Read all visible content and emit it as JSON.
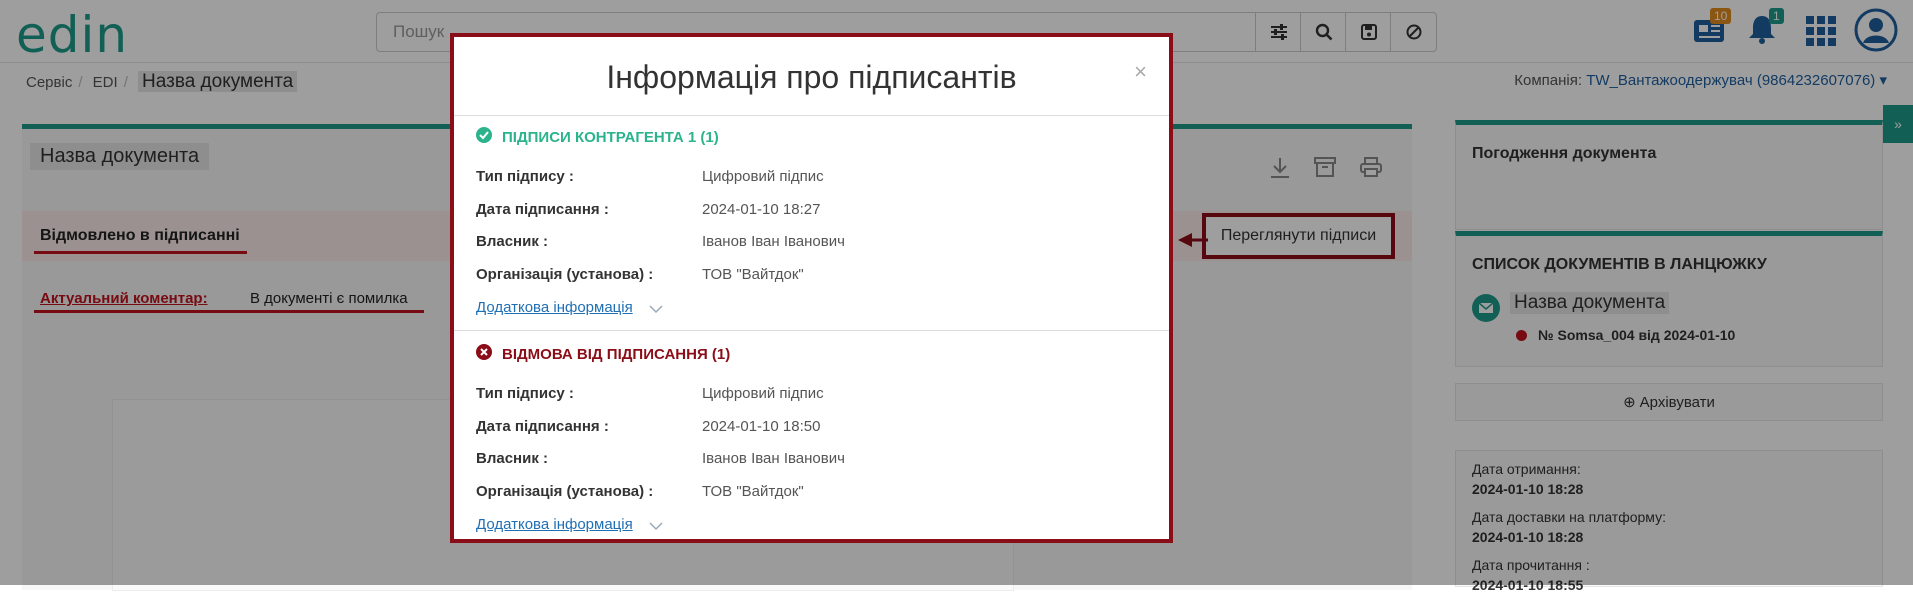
{
  "header": {
    "logo": "edin",
    "search_placeholder": "Пошук",
    "news_badge": "10",
    "notif_badge": "1"
  },
  "breadcrumbs": [
    "Сервіс",
    "EDI",
    "Назва документа"
  ],
  "company": {
    "label": "Компанія:",
    "name": "TW_Вантажоодержувач (9864232607076)"
  },
  "document": {
    "title": "Назва документа",
    "status": "Відмовлено в підписанні",
    "comment_label": "Актуальний коментар:",
    "comment_text": "В документі є помилка",
    "view_signatures": "Переглянути підписи"
  },
  "right": {
    "approval_title": "Погодження документа",
    "chain_title": "СПИСОК ДОКУМЕНТІВ В ЛАНЦЮЖКУ",
    "chain_doc": "Назва документа",
    "chain_number": "№ Somsa_004 від 2024-01-10",
    "archive": "Архівувати",
    "received_label": "Дата отримання:",
    "received_value": "2024-01-10 18:28",
    "delivered_label": "Дата доставки на платформу:",
    "delivered_value": "2024-01-10 18:28",
    "read_label": "Дата прочитання :",
    "read_value": "2024-01-10 18:55"
  },
  "modal": {
    "title": "Інформація про підписантів",
    "close": "×",
    "section1": {
      "heading": "ПІДПИСИ КОНТРАГЕНТА 1 (1)",
      "type_label": "Тип підпису :",
      "type_value": "Цифровий підпис",
      "date_label": "Дата підписання :",
      "date_value": "2024-01-10 18:27",
      "owner_label": "Власник :",
      "owner_value": "Іванов Іван Іванович",
      "org_label": "Організація (установа) :",
      "org_value": "ТОВ \"Вайтдок\"",
      "more": "Додаткова інформація"
    },
    "section2": {
      "heading": "ВІДМОВА ВІД ПІДПИСАННЯ (1)",
      "type_label": "Тип підпису :",
      "type_value": "Цифровий підпис",
      "date_label": "Дата підписання :",
      "date_value": "2024-01-10 18:50",
      "owner_label": "Власник :",
      "owner_value": "Іванов Іван Іванович",
      "org_label": "Організація (установа) :",
      "org_value": "ТОВ \"Вайтдок\"",
      "more": "Додаткова інформація"
    }
  },
  "colors": {
    "accent": "#1d9b8a",
    "danger": "#8b0d18",
    "success": "#2bb38c",
    "link": "#1f6fb5"
  }
}
